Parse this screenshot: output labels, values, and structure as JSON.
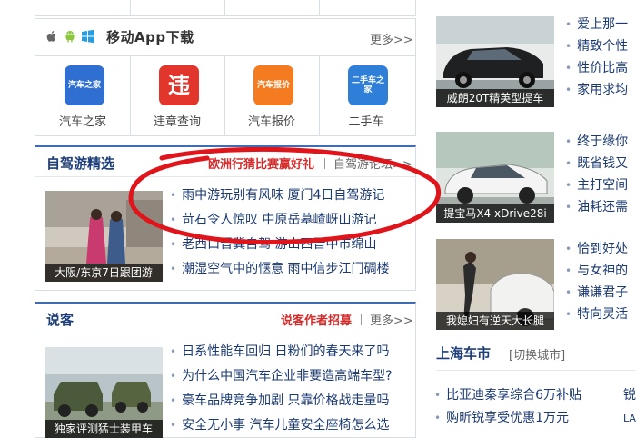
{
  "app_download": {
    "title": "移动App下载",
    "more": "更多>>",
    "apps": [
      {
        "label": "汽车之家",
        "icon_text": "汽车之家",
        "icon": "autohome-app-icon",
        "color": "#2f6fd1"
      },
      {
        "label": "违章查询",
        "icon_text": "违",
        "icon": "violation-query-app-icon",
        "color": "#e2362c"
      },
      {
        "label": "汽车报价",
        "icon_text": "汽车报价",
        "icon": "car-price-app-icon",
        "color": "#f47b1f"
      },
      {
        "label": "二手车",
        "icon_text": "二手车之家",
        "icon": "used-car-app-icon",
        "color": "#2f7fd8"
      }
    ]
  },
  "self_drive": {
    "title": "自驾游精选",
    "promo": "欧洲行猜比赛赢好礼",
    "forum": "自驾游论坛>>",
    "thumb_caption": "大阪/东京7日跟团游",
    "items": [
      "雨中游玩别有风味  厦门4日自驾游记",
      "苛石令人惊叹  中原岳墓嵖岈山游记",
      "老西口晋冀自驾  游山西晋中市绵山",
      "潮湿空气中的惬意  雨中信步江门碉楼"
    ]
  },
  "shuoke": {
    "title": "说客",
    "promo": "说客作者招募",
    "more": "更多>>",
    "thumb_caption": "独家评测猛士装甲车",
    "items": [
      "日系性能车回归  日粉们的春天来了吗",
      "为什么中国汽车企业非要造高端车型?",
      "豪车品牌竞争加剧  只靠价格战走量吗",
      "安全无小事  汽车儿童安全座椅怎么选"
    ]
  },
  "right_cards": [
    {
      "caption": "威朗20T精英型提车",
      "items": [
        "爱上那一",
        "精致个性",
        "性价比高",
        "家用求均"
      ]
    },
    {
      "caption": "提宝马X4 xDrive28i",
      "items": [
        "终于缘你",
        "既省钱又",
        "主打空间",
        "油耗还需"
      ]
    },
    {
      "caption": "我媳妇有逆天大长腿",
      "items": [
        "恰到好处",
        "与女神的",
        "谦谦君子",
        "特向灵活"
      ]
    }
  ],
  "city_market": {
    "title": "上海车市",
    "switch": "[切换城市]",
    "items": [
      "比亚迪秦享综合6万补贴",
      "购昕锐享受优惠1万元"
    ],
    "side": [
      "锐",
      "LA"
    ]
  },
  "colors": {
    "accent_blue": "#3f6cb4",
    "link_blue": "#1b3a73",
    "promo_red": "#d42c2c",
    "annotation_red": "#e0141b"
  }
}
